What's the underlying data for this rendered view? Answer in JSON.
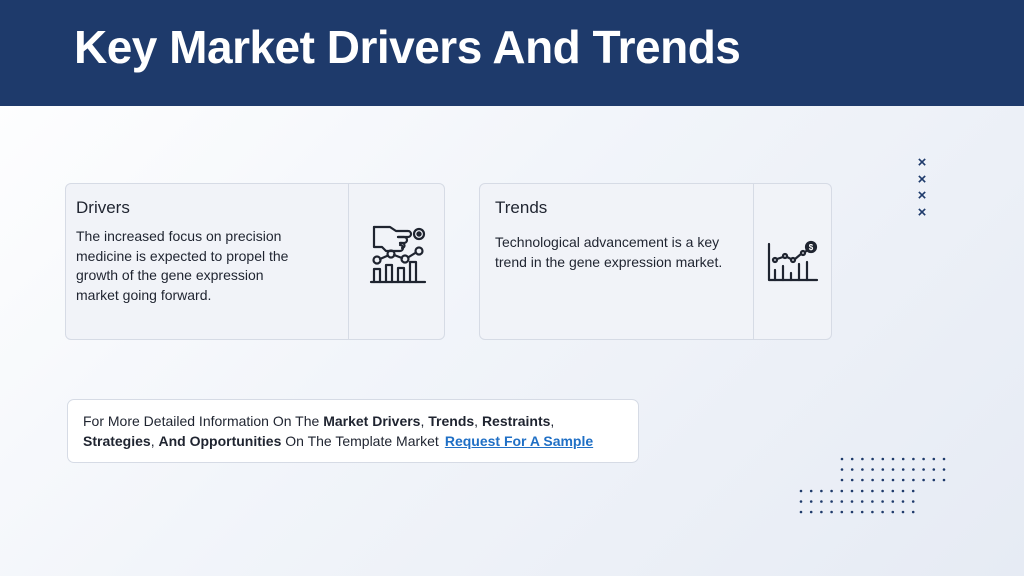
{
  "header": {
    "title": "Key Market Drivers And Trends",
    "background_color": "#1e3a6b"
  },
  "drivers_card": {
    "title": "Drivers",
    "text": "The increased focus on precision medicine is expected to propel the growth of the gene expression market going forward.",
    "icon": "hand-chart-icon"
  },
  "trends_card": {
    "title": "Trends",
    "text": "Technological advancement is a key trend in the gene expression market.",
    "icon": "growth-chart-dollar-icon"
  },
  "decor": {
    "x_marks": [
      "×",
      "×",
      "×",
      "×"
    ],
    "x_mark_color": "#1e3a6b",
    "dot_color": "#1e3a6b"
  },
  "info": {
    "prefix": "For More Detailed Information On The ",
    "market_drivers": "Market Drivers",
    "sep1": ", ",
    "trends": "Trends",
    "sep2": ", ",
    "restraints": "Restraints",
    "sep3": ",",
    "strategies": "Strategies",
    "sep4": ", ",
    "opportunities": "And Opportunities",
    "suffix": " On The Template Market",
    "link_label": "Request For A Sample",
    "link_color": "#1f6fc5"
  }
}
